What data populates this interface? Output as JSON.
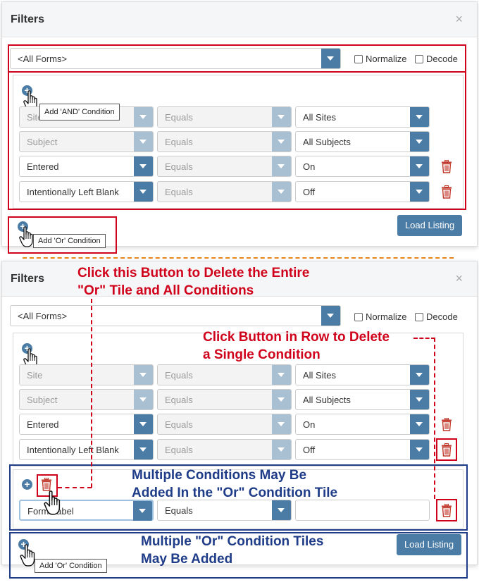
{
  "panel1": {
    "title": "Filters",
    "close": "×",
    "form_select": "<All Forms>",
    "normalize": "Normalize",
    "decode": "Decode",
    "and_tooltip": "Add 'AND' Condition",
    "rows": [
      {
        "field": "Site",
        "op": "Equals",
        "value": "All Sites"
      },
      {
        "field": "Subject",
        "op": "Equals",
        "value": "All Subjects"
      },
      {
        "field": "Entered",
        "op": "Equals",
        "value": "On"
      },
      {
        "field": "Intentionally Left Blank",
        "op": "Equals",
        "value": "Off"
      }
    ],
    "or_tooltip": "Add 'Or' Condition",
    "load_listing": "Load Listing"
  },
  "panel2": {
    "title": "Filters",
    "close": "×",
    "form_select": "<All Forms>",
    "normalize": "Normalize",
    "decode": "Decode",
    "rows": [
      {
        "field": "Site",
        "op": "Equals",
        "value": "All Sites"
      },
      {
        "field": "Subject",
        "op": "Equals",
        "value": "All Subjects"
      },
      {
        "field": "Entered",
        "op": "Equals",
        "value": "On"
      },
      {
        "field": "Intentionally Left Blank",
        "op": "Equals",
        "value": "Off"
      }
    ],
    "or_row": {
      "field": "Form Label",
      "op": "Equals",
      "value": ""
    },
    "or_tooltip": "Add 'Or' Condition",
    "load_listing": "Load Listing"
  },
  "annotations": {
    "delete_tile_1": "Click this Button to Delete the Entire",
    "delete_tile_2": "\"Or\" Tile and All Conditions",
    "delete_row_1": "Click Button in Row to Delete",
    "delete_row_2": "a Single Condition",
    "multi_cond_1": "Multiple Conditions May Be",
    "multi_cond_2": "Added In the \"Or\" Condition Tile",
    "multi_tiles_1": "Multiple \"Or\" Condition Tiles",
    "multi_tiles_2": "May Be Added"
  },
  "colors": {
    "accent": "#4a7ca6",
    "annotation_red": "#d0021b",
    "annotation_blue": "#1f3c88",
    "separator": "#e8841a"
  }
}
